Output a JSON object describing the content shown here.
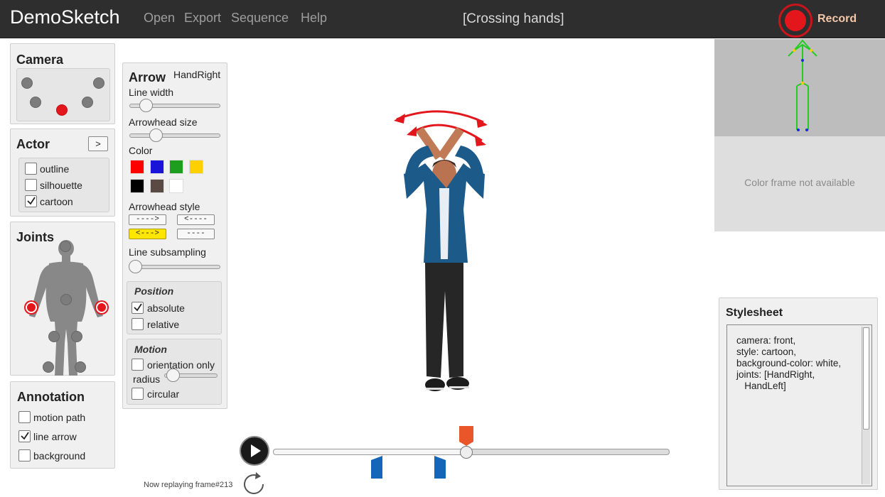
{
  "app": {
    "title": "DemoSketch",
    "document_title": "[Crossing hands]"
  },
  "menu": {
    "open": "Open",
    "export": "Export",
    "sequence": "Sequence",
    "help": "Help"
  },
  "record": {
    "label": "Record",
    "color": "#e3161c"
  },
  "camera": {
    "title": "Camera"
  },
  "actor": {
    "title": "Actor",
    "next_button": ">",
    "options": [
      {
        "label": "outline",
        "checked": false
      },
      {
        "label": "silhouette",
        "checked": false
      },
      {
        "label": "cartoon",
        "checked": true
      }
    ]
  },
  "joints": {
    "title": "Joints",
    "selected_color": "#e3161c"
  },
  "annotation": {
    "title": "Annotation",
    "options": [
      {
        "label": "motion path",
        "checked": false
      },
      {
        "label": "line arrow",
        "checked": true
      },
      {
        "label": "background",
        "checked": false
      }
    ]
  },
  "arrow": {
    "title": "Arrow",
    "target": "HandRight",
    "line_width_label": "Line width",
    "line_width": 0.12,
    "arrowhead_size_label": "Arrowhead size",
    "arrowhead_size": 0.24,
    "color_label": "Color",
    "colors": [
      "#ff0000",
      "#1a14d9",
      "#1e9e1e",
      "#ffd000",
      "#000000",
      "#5a4a44",
      "#ffffff"
    ],
    "arrowhead_style_label": "Arrowhead style",
    "styles": [
      "---->",
      "<----",
      "<--->",
      "----"
    ],
    "selected_style": "<--->",
    "subsampling_label": "Line subsampling",
    "subsampling": 0.0,
    "position": {
      "title": "Position",
      "options": [
        {
          "label": "absolute",
          "checked": true
        },
        {
          "label": "relative",
          "checked": false
        }
      ]
    },
    "motion": {
      "title": "Motion",
      "orientation_label": "orientation only",
      "radius_label": "radius",
      "radius": 0.18,
      "circular_label": "circular",
      "orientation_checked": false,
      "circular_checked": false
    }
  },
  "preview": {
    "unavailable_text": "Color frame not available"
  },
  "stylesheet": {
    "title": "Stylesheet",
    "lines": [
      "camera: front,",
      "style: cartoon,",
      "background-color: white,",
      "joints: [HandRight,",
      "   HandLeft]"
    ]
  },
  "timeline": {
    "status": "Now replaying frame#213",
    "progress": 0.49
  }
}
